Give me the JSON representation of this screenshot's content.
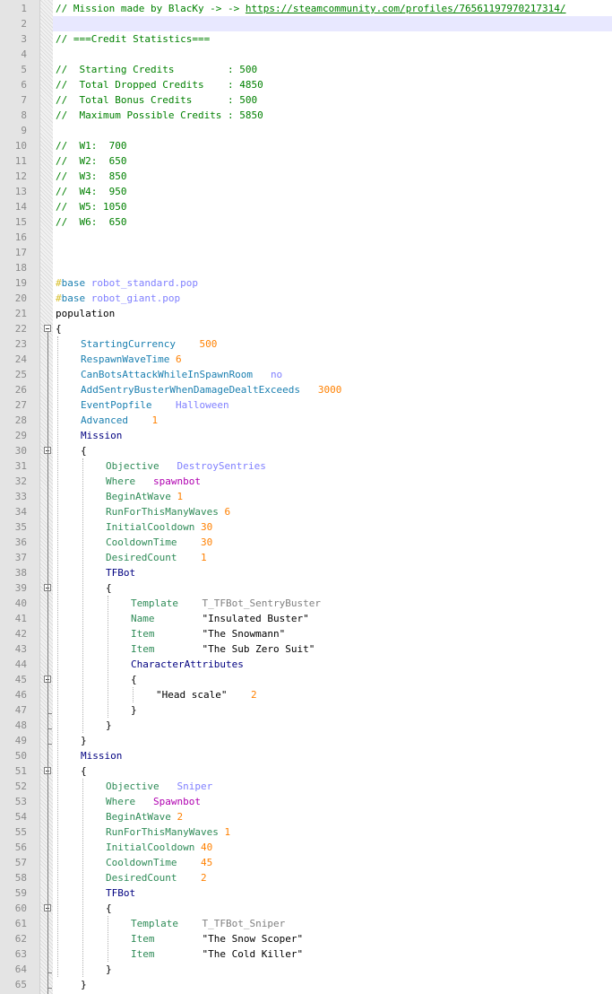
{
  "editor": {
    "line_numbers": [
      "1",
      "2",
      "3",
      "4",
      "5",
      "6",
      "7",
      "8",
      "9",
      "10",
      "11",
      "12",
      "13",
      "14",
      "15",
      "16",
      "17",
      "18",
      "19",
      "20",
      "21",
      "22",
      "23",
      "24",
      "25",
      "26",
      "27",
      "28",
      "29",
      "30",
      "31",
      "32",
      "33",
      "34",
      "35",
      "36",
      "37",
      "38",
      "39",
      "40",
      "41",
      "42",
      "43",
      "44",
      "45",
      "46",
      "47",
      "48",
      "49",
      "50",
      "51",
      "52",
      "53",
      "54",
      "55",
      "56",
      "57",
      "58",
      "59",
      "60",
      "61",
      "62",
      "63",
      "64",
      "65"
    ],
    "lines": [
      {
        "indent": 0,
        "tokens": [
          {
            "t": "// Mission made by BlacKy -> -> ",
            "c": "comment"
          },
          {
            "t": "https://steamcommunity.com/profiles/76561197970217314/",
            "c": "link"
          }
        ]
      },
      {
        "indent": 0,
        "tokens": [],
        "current": true
      },
      {
        "indent": 0,
        "tokens": [
          {
            "t": "// ===Credit Statistics===",
            "c": "comment"
          }
        ]
      },
      {
        "indent": 0,
        "tokens": []
      },
      {
        "indent": 0,
        "tokens": [
          {
            "t": "//  Starting Credits         : 500",
            "c": "comment"
          }
        ]
      },
      {
        "indent": 0,
        "tokens": [
          {
            "t": "//  Total Dropped Credits    : 4850",
            "c": "comment"
          }
        ]
      },
      {
        "indent": 0,
        "tokens": [
          {
            "t": "//  Total Bonus Credits      : 500",
            "c": "comment"
          }
        ]
      },
      {
        "indent": 0,
        "tokens": [
          {
            "t": "//  Maximum Possible Credits : 5850",
            "c": "comment"
          }
        ]
      },
      {
        "indent": 0,
        "tokens": []
      },
      {
        "indent": 0,
        "tokens": [
          {
            "t": "//  W1:  700",
            "c": "comment"
          }
        ]
      },
      {
        "indent": 0,
        "tokens": [
          {
            "t": "//  W2:  650",
            "c": "comment"
          }
        ]
      },
      {
        "indent": 0,
        "tokens": [
          {
            "t": "//  W3:  850",
            "c": "comment"
          }
        ]
      },
      {
        "indent": 0,
        "tokens": [
          {
            "t": "//  W4:  950",
            "c": "comment"
          }
        ]
      },
      {
        "indent": 0,
        "tokens": [
          {
            "t": "//  W5: 1050",
            "c": "comment"
          }
        ]
      },
      {
        "indent": 0,
        "tokens": [
          {
            "t": "//  W6:  650",
            "c": "comment"
          }
        ]
      },
      {
        "indent": 0,
        "tokens": []
      },
      {
        "indent": 0,
        "tokens": []
      },
      {
        "indent": 0,
        "tokens": []
      },
      {
        "indent": 0,
        "tokens": [
          {
            "t": "#",
            "c": "hash"
          },
          {
            "t": "base",
            "c": "key"
          },
          {
            "t": " robot_standard.pop",
            "c": "val"
          }
        ]
      },
      {
        "indent": 0,
        "tokens": [
          {
            "t": "#",
            "c": "hash"
          },
          {
            "t": "base",
            "c": "key"
          },
          {
            "t": " robot_giant.pop",
            "c": "val"
          }
        ]
      },
      {
        "indent": 0,
        "tokens": [
          {
            "t": "population",
            "c": "black"
          }
        ]
      },
      {
        "indent": 0,
        "tokens": [
          {
            "t": "{",
            "c": "black"
          }
        ]
      },
      {
        "indent": 1,
        "tokens": [
          {
            "t": "StartingCurrency",
            "c": "key"
          },
          {
            "t": "    ",
            "c": "black"
          },
          {
            "t": "500",
            "c": "num"
          }
        ]
      },
      {
        "indent": 1,
        "tokens": [
          {
            "t": "RespawnWaveTime",
            "c": "key"
          },
          {
            "t": " ",
            "c": "black"
          },
          {
            "t": "6",
            "c": "num"
          }
        ]
      },
      {
        "indent": 1,
        "tokens": [
          {
            "t": "CanBotsAttackWhileInSpawnRoom",
            "c": "key"
          },
          {
            "t": "   ",
            "c": "black"
          },
          {
            "t": "no",
            "c": "val"
          }
        ]
      },
      {
        "indent": 1,
        "tokens": [
          {
            "t": "AddSentryBusterWhenDamageDealtExceeds",
            "c": "key"
          },
          {
            "t": "   ",
            "c": "black"
          },
          {
            "t": "3000",
            "c": "num"
          }
        ]
      },
      {
        "indent": 1,
        "tokens": [
          {
            "t": "EventPopfile",
            "c": "key"
          },
          {
            "t": "    ",
            "c": "black"
          },
          {
            "t": "Halloween",
            "c": "val"
          }
        ]
      },
      {
        "indent": 1,
        "tokens": [
          {
            "t": "Advanced",
            "c": "key"
          },
          {
            "t": "    ",
            "c": "black"
          },
          {
            "t": "1",
            "c": "num"
          }
        ]
      },
      {
        "indent": 1,
        "tokens": [
          {
            "t": "Mission",
            "c": "dark"
          }
        ]
      },
      {
        "indent": 1,
        "tokens": [
          {
            "t": "{",
            "c": "black"
          }
        ]
      },
      {
        "indent": 2,
        "tokens": [
          {
            "t": "Objective",
            "c": "green"
          },
          {
            "t": "   ",
            "c": "black"
          },
          {
            "t": "DestroySentries",
            "c": "val"
          }
        ]
      },
      {
        "indent": 2,
        "tokens": [
          {
            "t": "Where",
            "c": "green"
          },
          {
            "t": "   ",
            "c": "black"
          },
          {
            "t": "spawnbot",
            "c": "magenta"
          }
        ]
      },
      {
        "indent": 2,
        "tokens": [
          {
            "t": "BeginAtWave",
            "c": "green"
          },
          {
            "t": " ",
            "c": "black"
          },
          {
            "t": "1",
            "c": "num"
          }
        ]
      },
      {
        "indent": 2,
        "tokens": [
          {
            "t": "RunForThisManyWaves",
            "c": "green"
          },
          {
            "t": " ",
            "c": "black"
          },
          {
            "t": "6",
            "c": "num"
          }
        ]
      },
      {
        "indent": 2,
        "tokens": [
          {
            "t": "InitialCooldown",
            "c": "green"
          },
          {
            "t": " ",
            "c": "black"
          },
          {
            "t": "30",
            "c": "num"
          }
        ]
      },
      {
        "indent": 2,
        "tokens": [
          {
            "t": "CooldownTime",
            "c": "green"
          },
          {
            "t": "    ",
            "c": "black"
          },
          {
            "t": "30",
            "c": "num"
          }
        ]
      },
      {
        "indent": 2,
        "tokens": [
          {
            "t": "DesiredCount",
            "c": "green"
          },
          {
            "t": "    ",
            "c": "black"
          },
          {
            "t": "1",
            "c": "num"
          }
        ]
      },
      {
        "indent": 2,
        "tokens": [
          {
            "t": "TFBot",
            "c": "dark"
          }
        ]
      },
      {
        "indent": 2,
        "tokens": [
          {
            "t": "{",
            "c": "black"
          }
        ]
      },
      {
        "indent": 3,
        "tokens": [
          {
            "t": "Template",
            "c": "green"
          },
          {
            "t": "    ",
            "c": "black"
          },
          {
            "t": "T_TFBot_SentryBuster",
            "c": "str"
          }
        ]
      },
      {
        "indent": 3,
        "tokens": [
          {
            "t": "Name",
            "c": "green"
          },
          {
            "t": "        ",
            "c": "black"
          },
          {
            "t": "\"Insulated Buster\"",
            "c": "black"
          }
        ]
      },
      {
        "indent": 3,
        "tokens": [
          {
            "t": "Item",
            "c": "green"
          },
          {
            "t": "        ",
            "c": "black"
          },
          {
            "t": "\"The Snowmann\"",
            "c": "black"
          }
        ]
      },
      {
        "indent": 3,
        "tokens": [
          {
            "t": "Item",
            "c": "green"
          },
          {
            "t": "        ",
            "c": "black"
          },
          {
            "t": "\"The Sub Zero Suit\"",
            "c": "black"
          }
        ]
      },
      {
        "indent": 3,
        "tokens": [
          {
            "t": "CharacterAttributes",
            "c": "dark"
          }
        ]
      },
      {
        "indent": 3,
        "tokens": [
          {
            "t": "{",
            "c": "black"
          }
        ]
      },
      {
        "indent": 4,
        "tokens": [
          {
            "t": "\"Head scale\"",
            "c": "black"
          },
          {
            "t": "    ",
            "c": "black"
          },
          {
            "t": "2",
            "c": "num"
          }
        ]
      },
      {
        "indent": 3,
        "tokens": [
          {
            "t": "}",
            "c": "black"
          }
        ]
      },
      {
        "indent": 2,
        "tokens": [
          {
            "t": "}",
            "c": "black"
          }
        ]
      },
      {
        "indent": 1,
        "tokens": [
          {
            "t": "}",
            "c": "black"
          }
        ]
      },
      {
        "indent": 1,
        "tokens": [
          {
            "t": "Mission",
            "c": "dark"
          }
        ]
      },
      {
        "indent": 1,
        "tokens": [
          {
            "t": "{",
            "c": "black"
          }
        ]
      },
      {
        "indent": 2,
        "tokens": [
          {
            "t": "Objective",
            "c": "green"
          },
          {
            "t": "   ",
            "c": "black"
          },
          {
            "t": "Sniper",
            "c": "val"
          }
        ]
      },
      {
        "indent": 2,
        "tokens": [
          {
            "t": "Where",
            "c": "green"
          },
          {
            "t": "   ",
            "c": "black"
          },
          {
            "t": "Spawnbot",
            "c": "magenta"
          }
        ]
      },
      {
        "indent": 2,
        "tokens": [
          {
            "t": "BeginAtWave",
            "c": "green"
          },
          {
            "t": " ",
            "c": "black"
          },
          {
            "t": "2",
            "c": "num"
          }
        ]
      },
      {
        "indent": 2,
        "tokens": [
          {
            "t": "RunForThisManyWaves",
            "c": "green"
          },
          {
            "t": " ",
            "c": "black"
          },
          {
            "t": "1",
            "c": "num"
          }
        ]
      },
      {
        "indent": 2,
        "tokens": [
          {
            "t": "InitialCooldown",
            "c": "green"
          },
          {
            "t": " ",
            "c": "black"
          },
          {
            "t": "40",
            "c": "num"
          }
        ]
      },
      {
        "indent": 2,
        "tokens": [
          {
            "t": "CooldownTime",
            "c": "green"
          },
          {
            "t": "    ",
            "c": "black"
          },
          {
            "t": "45",
            "c": "num"
          }
        ]
      },
      {
        "indent": 2,
        "tokens": [
          {
            "t": "DesiredCount",
            "c": "green"
          },
          {
            "t": "    ",
            "c": "black"
          },
          {
            "t": "2",
            "c": "num"
          }
        ]
      },
      {
        "indent": 2,
        "tokens": [
          {
            "t": "TFBot",
            "c": "dark"
          }
        ]
      },
      {
        "indent": 2,
        "tokens": [
          {
            "t": "{",
            "c": "black"
          }
        ]
      },
      {
        "indent": 3,
        "tokens": [
          {
            "t": "Template",
            "c": "green"
          },
          {
            "t": "    ",
            "c": "black"
          },
          {
            "t": "T_TFBot_Sniper",
            "c": "str"
          }
        ]
      },
      {
        "indent": 3,
        "tokens": [
          {
            "t": "Item",
            "c": "green"
          },
          {
            "t": "        ",
            "c": "black"
          },
          {
            "t": "\"The Snow Scoper\"",
            "c": "black"
          }
        ]
      },
      {
        "indent": 3,
        "tokens": [
          {
            "t": "Item",
            "c": "green"
          },
          {
            "t": "        ",
            "c": "black"
          },
          {
            "t": "\"The Cold Killer\"",
            "c": "black"
          }
        ]
      },
      {
        "indent": 2,
        "tokens": [
          {
            "t": "}",
            "c": "black"
          }
        ]
      },
      {
        "indent": 1,
        "tokens": [
          {
            "t": "}",
            "c": "black"
          }
        ]
      }
    ],
    "fold_open_lines": [
      22,
      30,
      39,
      45,
      51,
      60
    ],
    "fold_end_lines": [
      47,
      48,
      49,
      64,
      65
    ],
    "colors": {
      "comment": "#008000",
      "keyword": "#1a7fb0",
      "number": "#ff8000",
      "value": "#8080ff",
      "current_line": "#e8e8ff",
      "gutter": "#e4e4e4"
    }
  }
}
